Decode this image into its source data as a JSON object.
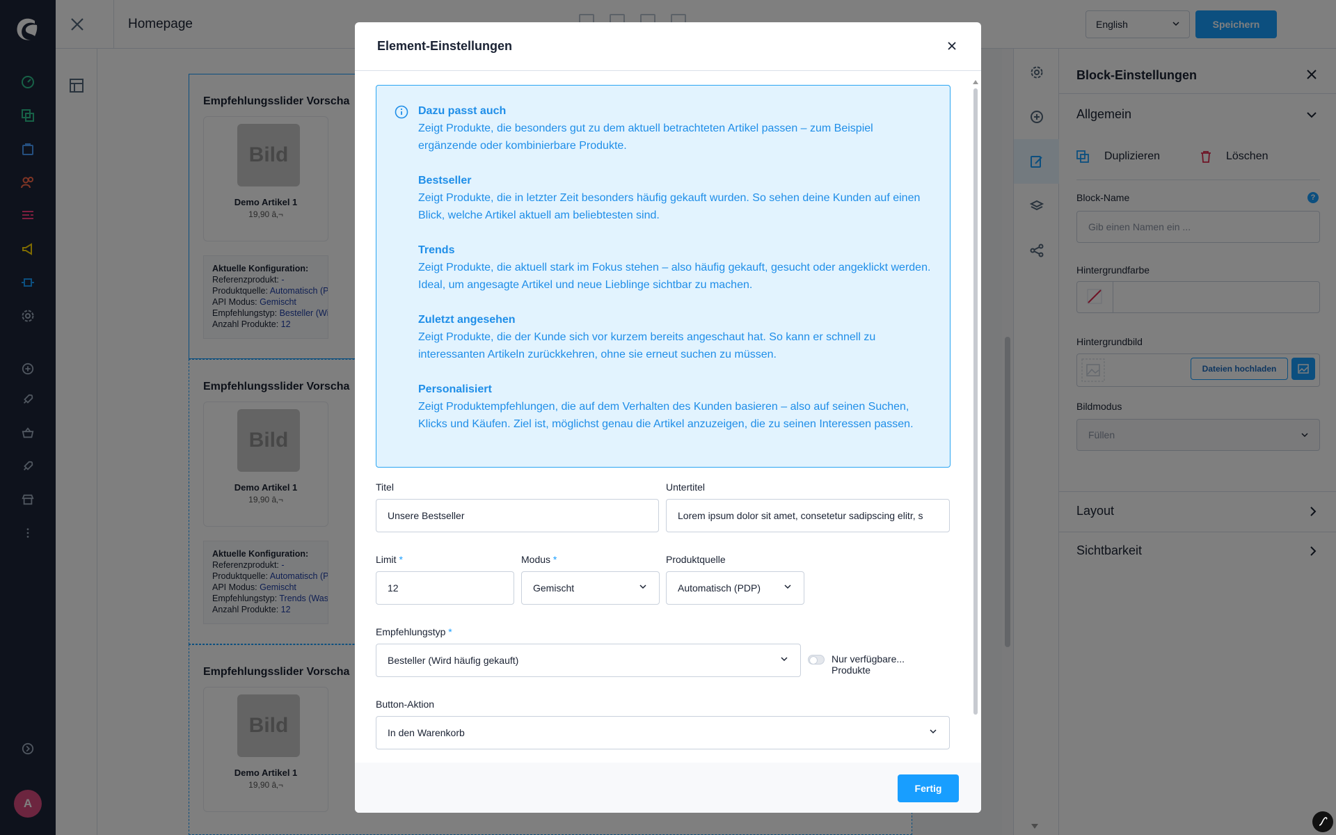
{
  "topbar": {
    "title": "Homepage",
    "language": "English",
    "save_label": "Speichern"
  },
  "canvas": {
    "blocks": [
      {
        "title": "Empfehlungsslider Vorscha",
        "image_label": "Bild",
        "product_name": "Demo Artikel 1",
        "price": "19,90 â‚¬",
        "config_title": "Aktuelle Konfiguration:",
        "config": [
          {
            "key": "Referenzprodukt:",
            "value": " -"
          },
          {
            "key": "Produktquelle:",
            "value": " Automatisch (PDP)"
          },
          {
            "key": "API Modus:",
            "value": " Gemischt"
          },
          {
            "key": "Empfehlungstyp:",
            "value": " Besteller (Wird h"
          },
          {
            "key": "Anzahl Produkte:",
            "value": " 12"
          }
        ]
      },
      {
        "title": "Empfehlungsslider Vorscha",
        "image_label": "Bild",
        "product_name": "Demo Artikel 1",
        "price": "19,90 â‚¬",
        "config_title": "Aktuelle Konfiguration:",
        "config": [
          {
            "key": "Referenzprodukt:",
            "value": " -"
          },
          {
            "key": "Produktquelle:",
            "value": " Automatisch (PDP)"
          },
          {
            "key": "API Modus:",
            "value": " Gemischt"
          },
          {
            "key": "Empfehlungstyp:",
            "value": " Trends (Was wu"
          },
          {
            "key": "Anzahl Produkte:",
            "value": " 12"
          }
        ]
      },
      {
        "title": "Empfehlungsslider Vorscha",
        "image_label": "Bild",
        "product_name": "Demo Artikel 1",
        "price": "19,90 â‚¬"
      }
    ]
  },
  "right_panel": {
    "title": "Block-Einstellungen",
    "section_general": "Allgemein",
    "duplicate_label": "Duplizieren",
    "delete_label": "Löschen",
    "block_name_label": "Block-Name",
    "block_name_placeholder": "Gib einen Namen ein ...",
    "bg_color_label": "Hintergrundfarbe",
    "bg_image_label": "Hintergrundbild",
    "upload_label": "Dateien hochladen",
    "image_mode_label": "Bildmodus",
    "image_mode_value": "Füllen",
    "section_layout": "Layout",
    "section_visibility": "Sichtbarkeit"
  },
  "modal": {
    "title": "Element-Einstellungen",
    "info": [
      {
        "heading": "Dazu passt auch",
        "text": "Zeigt Produkte, die besonders gut zu dem aktuell betrachteten Artikel passen – zum Beispiel ergänzende oder kombinierbare Produkte."
      },
      {
        "heading": "Bestseller",
        "text": "Zeigt Produkte, die in letzter Zeit besonders häufig gekauft wurden. So sehen deine Kunden auf einen Blick, welche Artikel aktuell am beliebtesten sind."
      },
      {
        "heading": "Trends",
        "text": "Zeigt Produkte, die aktuell stark im Fokus stehen – also häufig gekauft, gesucht oder angeklickt werden. Ideal, um angesagte Artikel und neue Lieblinge sichtbar zu machen."
      },
      {
        "heading": "Zuletzt angesehen",
        "text": "Zeigt Produkte, die der Kunde sich vor kurzem bereits angeschaut hat. So kann er schnell zu interessanten Artikeln zurückkehren, ohne sie erneut suchen zu müssen."
      },
      {
        "heading": "Personalisiert",
        "text": "Zeigt Produktempfehlungen, die auf dem Verhalten des Kunden basieren – also auf seinen Suchen, Klicks und Käufen. Ziel ist, möglichst genau die Artikel anzuzeigen, die zu seinen Interessen passen."
      }
    ],
    "title_label": "Titel",
    "title_value": "Unsere Bestseller",
    "subtitle_label": "Untertitel",
    "subtitle_value": "Lorem ipsum dolor sit amet, consetetur sadipscing elitr, s",
    "limit_label": "Limit",
    "limit_value": "12",
    "mode_label": "Modus",
    "mode_value": "Gemischt",
    "source_label": "Produktquelle",
    "source_value": "Automatisch (PDP)",
    "rec_type_label": "Empfehlungstyp",
    "rec_type_value": "Besteller (Wird häufig gekauft)",
    "only_available_label": "Nur verfügbare... Produkte",
    "button_action_label": "Button-Aktion",
    "button_action_value": "In den Warenkorb",
    "required_mark": "*",
    "done_label": "Fertig"
  },
  "user": {
    "initial": "A"
  },
  "colors": {
    "accent": "#189eff",
    "nav_bg": "#1d2438",
    "info_bg": "#e2f3fe",
    "info_text": "#1f8ee8"
  }
}
